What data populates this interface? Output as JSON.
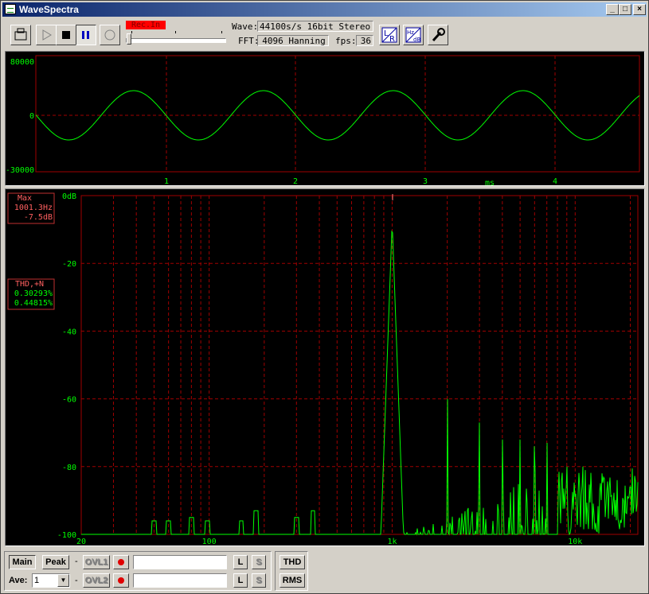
{
  "window": {
    "title": "WaveSpectra"
  },
  "toolbar": {
    "rec_in": "Rec.In",
    "wave_label": "Wave:",
    "wave_value": "44100s/s 16bit Stereo",
    "fft_label": "FFT:",
    "fft_value": "4096 Hanning",
    "fps_label": "fps:",
    "fps_value": "36",
    "lr_button": "LR"
  },
  "wave": {
    "y_ticks": [
      "80000",
      "0",
      "-30000"
    ],
    "x_ticks": [
      "1",
      "2",
      "3",
      "4"
    ],
    "x_unit": "ms"
  },
  "spectrum": {
    "y_ticks": [
      "0dB",
      "-20",
      "-40",
      "-60",
      "-80",
      "-100"
    ],
    "x_ticks": [
      "20",
      "100",
      "1k",
      "10k"
    ],
    "max_box": {
      "title": "Max",
      "freq": "1001.3Hz",
      "level": "-7.5dB"
    },
    "thd_box": {
      "title": "THD,+N",
      "thd": "0.30293%",
      "thdn": "0.44815%"
    }
  },
  "colors": {
    "trace": "#00ff00",
    "grid": "#a00000",
    "label": "#00ff00",
    "info": "#ff6060"
  },
  "bottom": {
    "main_btn": "Main",
    "peak_btn": "Peak",
    "ovl1": "OVL1",
    "ovl2": "OVL2",
    "dash": "-",
    "ave_label": "Ave:",
    "ave_value": "1",
    "l_btn": "L",
    "s_btn": "S",
    "thd_btn": "THD",
    "rms_btn": "RMS"
  }
}
